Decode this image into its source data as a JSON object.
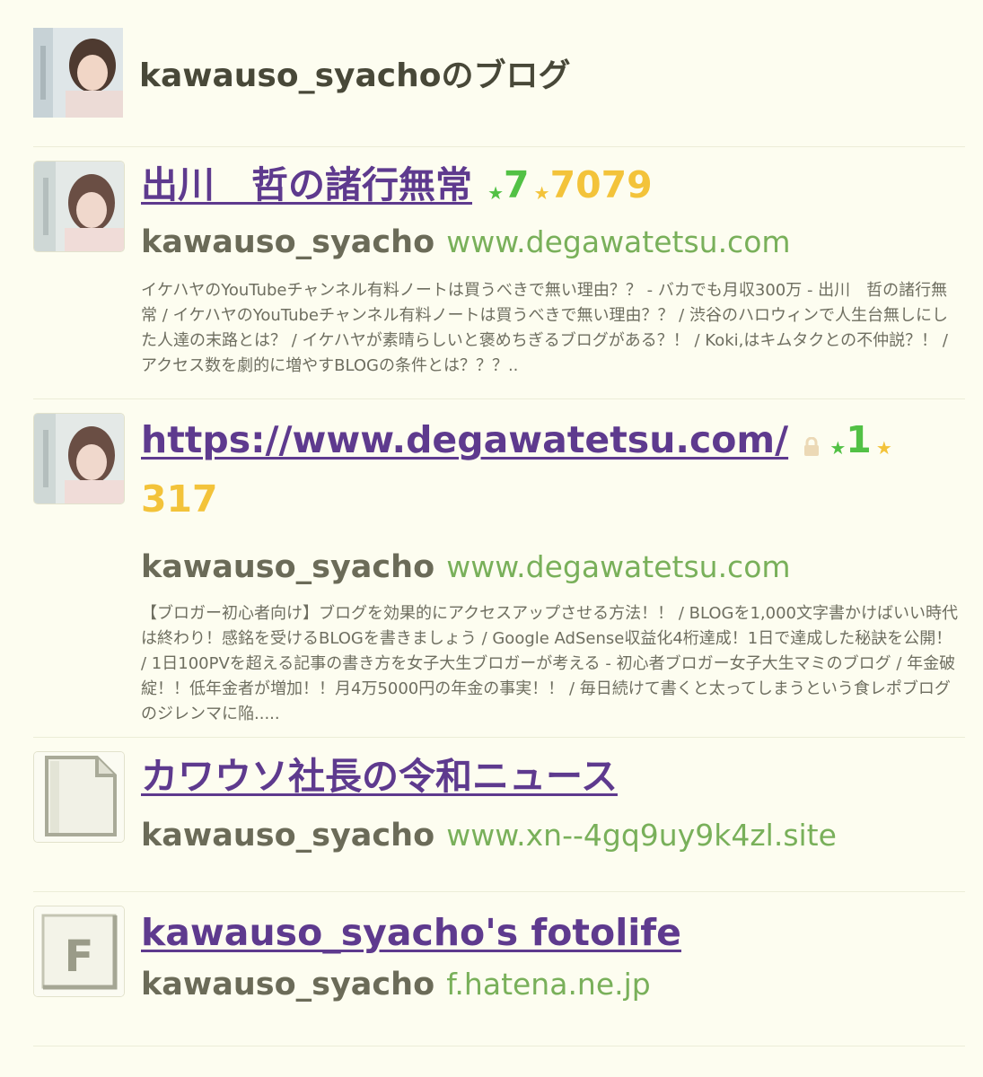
{
  "header": {
    "title": "kawauso_syachoのブログ"
  },
  "entries": [
    {
      "title": "出川　哲の諸行無常",
      "count_green": "7",
      "count_gold": "7079",
      "author": "kawauso_syacho",
      "domain": "www.degawatetsu.com",
      "description": "イケハヤのYouTubeチャンネル有料ノートは買うべきで無い理由？？ - バカでも月収300万 - 出川　哲の諸行無常 / イケハヤのYouTubeチャンネル有料ノートは買うべきで無い理由？？ / 渋谷のハロウィンで人生台無しにした人達の末路とは？ / イケハヤが素晴らしいと褒めちぎるブログがある？！ / Koki,はキムタクとの不仲説？！ / アクセス数を劇的に増やすBLOGの条件とは？？？.."
    },
    {
      "title": "https://www.degawatetsu.com/",
      "count_green": "1",
      "count_gold": "317",
      "author": "kawauso_syacho",
      "domain": "www.degawatetsu.com",
      "description": "【ブロガー初心者向け】ブログを効果的にアクセスアップさせる方法！！ / BLOGを1,000文字書かけばいい時代は終わり！感銘を受けるBLOGを書きましょう / Google AdSense収益化4桁達成！1日で達成した秘訣を公開！ / 1日100PVを超える記事の書き方を女子大生ブロガーが考える - 初心者ブロガー女子大生マミのブログ / 年金破綻！！低年金者が増加！！月4万5000円の年金の事実！！ / 毎日続けて書くと太ってしまうという食レポブログのジレンマに陥....."
    },
    {
      "title": "カワウソ社長の令和ニュース",
      "author": "kawauso_syacho",
      "domain": "www.xn--4gq9uy9k4zl.site"
    },
    {
      "title": "kawauso_syacho's fotolife",
      "author": "kawauso_syacho",
      "domain": "f.hatena.ne.jp",
      "icon_letter": "F"
    }
  ],
  "colors": {
    "background": "#fdfdf0",
    "link": "#5e3a8e",
    "domain": "#79b05a",
    "star_green": "#52c145",
    "star_gold": "#f3c33a"
  }
}
